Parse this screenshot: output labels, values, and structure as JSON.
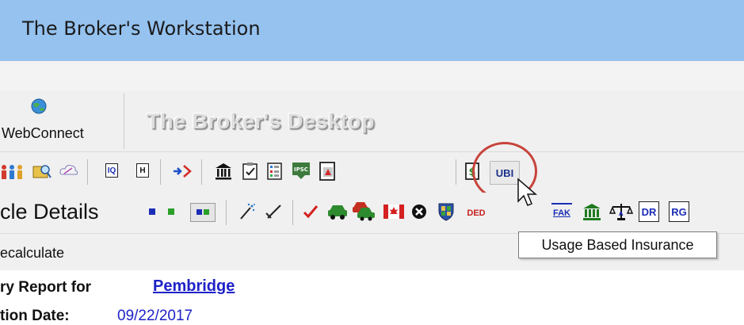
{
  "window": {
    "title": "The Broker's Workstation"
  },
  "big_toolbar": {
    "webconnect_label": "WebConnect",
    "desktop_title": "The Broker's Desktop"
  },
  "toolbar1": {
    "icons": [
      "people-icon",
      "folder-search-icon",
      "cloud-icon",
      "iq-document-icon",
      "h-document-icon",
      "merge-arrows-icon",
      "bank-icon",
      "checklist-icon",
      "document-grid-icon",
      "ipsc-stamp-icon",
      "pdf-document-icon",
      "dollar-document-icon"
    ],
    "ubi_label": "UBI",
    "ubi_tooltip": "Usage Based Insurance"
  },
  "toolbar2": {
    "label": "cle Details",
    "ded_label": "DED",
    "fak_label": "FAK",
    "dr_label": "DR",
    "rg_label": "RG"
  },
  "recalc": {
    "label": "ecalculate"
  },
  "report": {
    "summary_label": "ry Report for",
    "client_name": "Pembridge",
    "date_label": "tion Date:",
    "date_value": "09/22/2017"
  }
}
